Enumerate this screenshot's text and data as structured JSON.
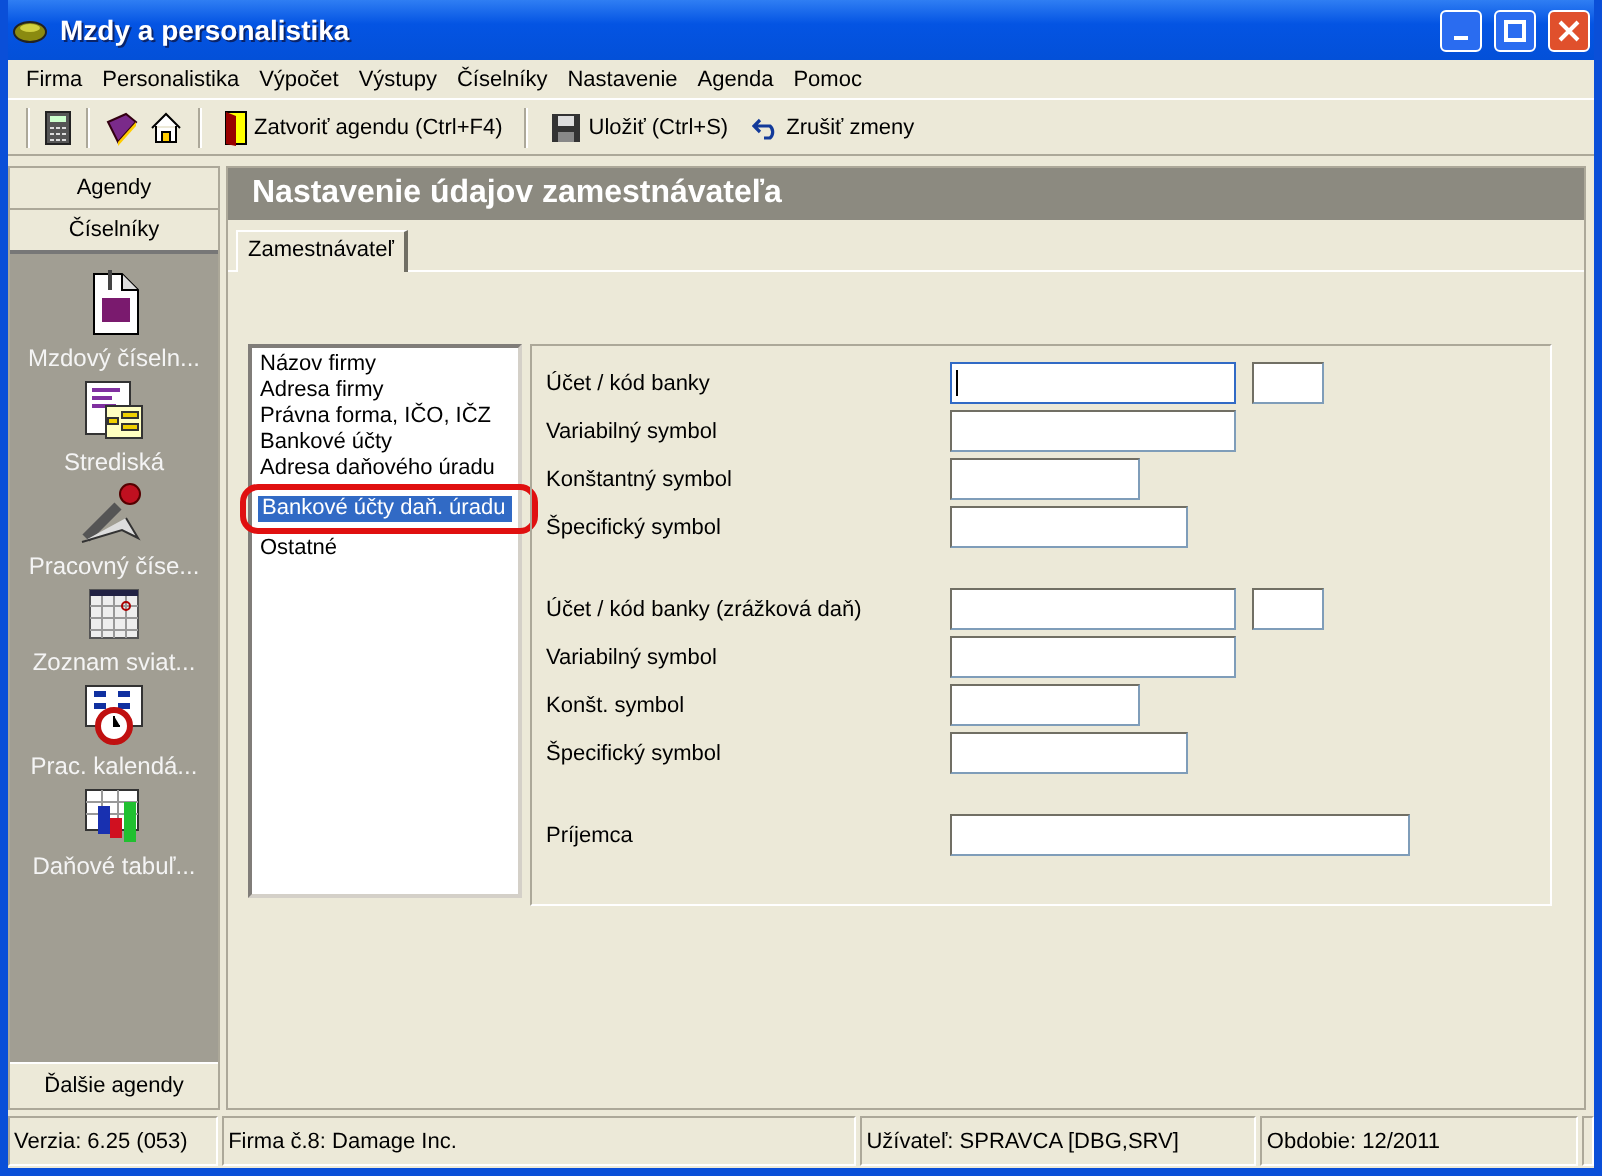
{
  "window": {
    "title": "Mzdy a personalistika"
  },
  "menu": [
    "Firma",
    "Personalistika",
    "Výpočet",
    "Výstupy",
    "Číselníky",
    "Nastavenie",
    "Agenda",
    "Pomoc"
  ],
  "toolbar": [
    "Zatvoriť agendu (Ctrl+F4)",
    "Uložiť (Ctrl+S)",
    "Zrušiť zmeny"
  ],
  "sidebar": {
    "tabs": [
      {
        "label": "Agendy",
        "selected": false
      },
      {
        "label": "Číselníky",
        "selected": true
      }
    ],
    "items": [
      "Mzdový číseln...",
      "Strediská",
      "Pracovný číse...",
      "Zoznam sviat...",
      "Prac. kalendá...",
      "Daňové tabuľ..."
    ],
    "footer": "Ďalšie agendy"
  },
  "header": "Nastavenie údajov zamestnávateľa",
  "tabs": [
    {
      "label": "Zamestnávateľ",
      "selected": true
    }
  ],
  "sections": [
    {
      "label": "Názov firmy",
      "selected": false
    },
    {
      "label": "Adresa firmy",
      "selected": false
    },
    {
      "label": "Právna forma, IČO, IČZ",
      "selected": false
    },
    {
      "label": "Bankové účty",
      "selected": false
    },
    {
      "label": "Adresa daňového úradu",
      "selected": false
    },
    {
      "label": "Bankové účty daň. úradu",
      "selected": true
    },
    {
      "label": "Ostatné",
      "selected": false
    }
  ],
  "form": [
    [
      {
        "label": "Účet / kód banky",
        "kind": "account",
        "focused": true
      },
      {
        "label": "Variabilný symbol",
        "kind": "wide",
        "focused": false
      },
      {
        "label": "Konštantný symbol",
        "kind": "short",
        "focused": false
      },
      {
        "label": "Špecifický symbol",
        "kind": "medium",
        "focused": false
      }
    ],
    [
      {
        "label": "Účet / kód banky (zrážková daň)",
        "kind": "account",
        "focused": false
      },
      {
        "label": "Variabilný symbol",
        "kind": "wide",
        "focused": false
      },
      {
        "label": "Konšt. symbol",
        "kind": "short",
        "focused": false
      },
      {
        "label": "Špecifický symbol",
        "kind": "medium",
        "focused": false
      }
    ],
    [
      {
        "label": "Príjemca",
        "kind": "long",
        "focused": false
      }
    ]
  ],
  "status_bar": [
    "Verzia: 6.25 (053)",
    "Firma č.8: Damage Inc.",
    "Užívateľ: SPRAVCA [DBG,SRV]",
    "Obdobie: 12/2011"
  ]
}
